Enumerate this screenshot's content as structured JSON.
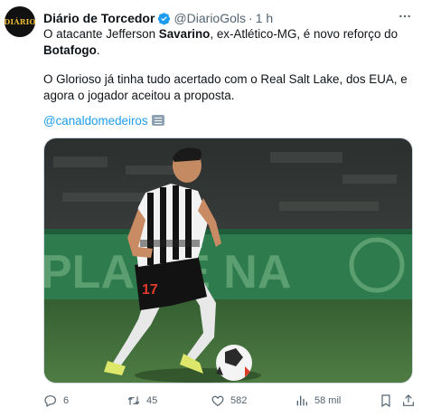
{
  "account": {
    "avatar_text": "DIÁRIO",
    "name": "Diário de Torcedor",
    "handle": "@DiarioGols",
    "separator": "·",
    "time": "1 h"
  },
  "tweet": {
    "p1_a": "O atacante Jefferson ",
    "p1_bold1": "Savarino",
    "p1_b": ", ex-Atlético-MG, é novo reforço do ",
    "p1_bold2": "Botafogo",
    "p1_c": ".",
    "p2": "O Glorioso já tinha tudo acertado com o Real Salt Lake, dos EUA, e agora o jogador aceitou a proposta.",
    "mention": "@canaldomedeiros",
    "media": {
      "jersey_number": "17",
      "banner_text": "PLAS É NA"
    }
  },
  "actions": {
    "replies": "6",
    "retweets": "45",
    "likes": "582",
    "views": "58 mil"
  },
  "colors": {
    "accent": "#1d9bf0",
    "muted": "#536471",
    "pitch": "#3c6b37",
    "banner": "#2f7a4a"
  }
}
